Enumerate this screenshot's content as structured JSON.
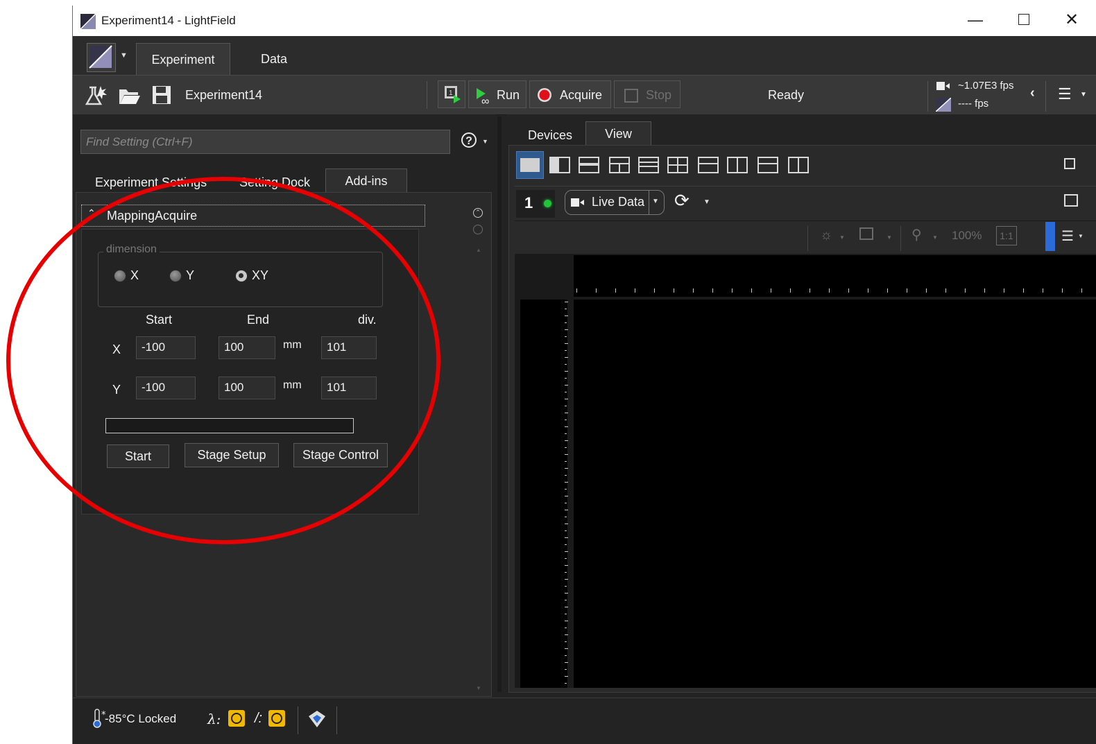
{
  "window": {
    "title": "Experiment14 - LightField"
  },
  "ribbon": {
    "tabs": [
      "Experiment",
      "Data"
    ]
  },
  "toolbar": {
    "experiment_name": "Experiment14",
    "run_label": "Run",
    "acquire_label": "Acquire",
    "stop_label": "Stop",
    "status": "Ready",
    "fps_top": "~1.07E3 fps",
    "fps_bottom": "---- fps"
  },
  "left_panel": {
    "search_placeholder": "Find Setting (Ctrl+F)",
    "tabs": [
      "Experiment Settings",
      "Setting Dock",
      "Add-ins"
    ],
    "addin": {
      "title": "MappingAcquire",
      "dimension_label": "dimension",
      "radios": [
        "X",
        "Y",
        "XY"
      ],
      "headers": {
        "start": "Start",
        "end": "End",
        "div": "div."
      },
      "rows": [
        {
          "axis": "X",
          "start": "-100",
          "end": "100",
          "unit": "mm",
          "div": "101"
        },
        {
          "axis": "Y",
          "start": "-100",
          "end": "100",
          "unit": "mm",
          "div": "101"
        }
      ],
      "buttons": {
        "start": "Start",
        "stage_setup": "Stage Setup",
        "stage_control": "Stage Control"
      },
      "progress": 0
    }
  },
  "right_panel": {
    "tabs": [
      "Devices",
      "View"
    ],
    "view_number": "1",
    "live_data_label": "Live Data",
    "zoom": "100%",
    "ratio": "1:1"
  },
  "statusbar": {
    "temperature": "-85°C Locked"
  },
  "colors": {
    "annotation": "#e60000",
    "accent_blue": "#2b6bd8",
    "live_led": "#22c23a",
    "warning": "#f2b800"
  }
}
